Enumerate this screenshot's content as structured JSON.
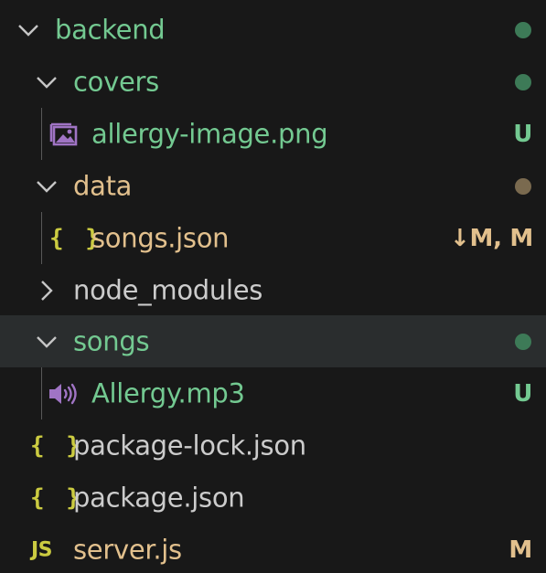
{
  "colors": {
    "background": "#181818",
    "selected_row": "#2a2d2e",
    "untracked_green": "#73c991",
    "modified_tan": "#e2c08d",
    "default_text": "#cccccc",
    "chevron": "#c5c5c5",
    "indent_guide": "#585858",
    "dot_green": "#3d7a57",
    "dot_tan": "#7a6a4f",
    "json_icon": "#cbcb41",
    "js_icon": "#cbcb41",
    "media_icon": "#a074c4"
  },
  "tree": {
    "backend": {
      "label": "backend",
      "expanded": true,
      "status": "dot",
      "icon": "chevron-down-icon"
    },
    "covers": {
      "label": "covers",
      "expanded": true,
      "status": "dot",
      "icon": "chevron-down-icon"
    },
    "allergy_image": {
      "label": "allergy-image.png",
      "badge": "U",
      "icon": "image-file-icon"
    },
    "data": {
      "label": "data",
      "expanded": true,
      "status": "dot",
      "icon": "chevron-down-icon"
    },
    "songs_json": {
      "label": "songs.json",
      "badge": "↓M, M",
      "icon_text": "{ }",
      "icon": "json-file-icon"
    },
    "node_modules": {
      "label": "node_modules",
      "expanded": false,
      "icon": "chevron-right-icon"
    },
    "songs": {
      "label": "songs",
      "expanded": true,
      "status": "dot",
      "selected": true,
      "icon": "chevron-down-icon"
    },
    "allergy_mp3": {
      "label": "Allergy.mp3",
      "badge": "U",
      "icon": "audio-file-icon"
    },
    "package_lock": {
      "label": "package-lock.json",
      "icon_text": "{ }",
      "icon": "json-file-icon"
    },
    "package_json": {
      "label": "package.json",
      "icon_text": "{ }",
      "icon": "json-file-icon"
    },
    "server_js": {
      "label": "server.js",
      "badge": "M",
      "icon_text": "JS",
      "icon": "js-file-icon"
    }
  }
}
